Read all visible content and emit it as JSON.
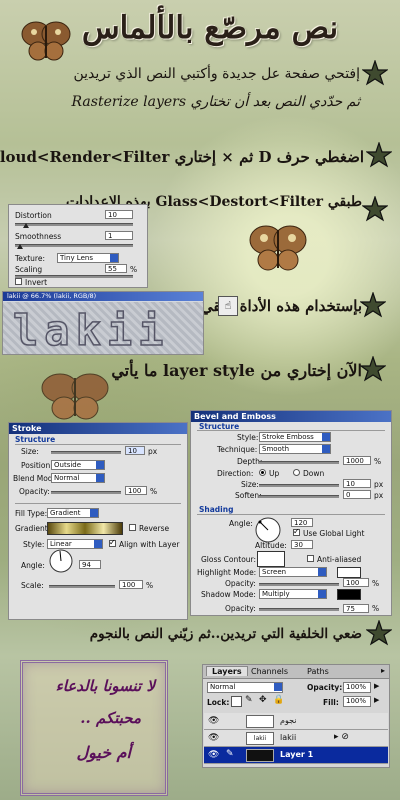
{
  "title": "نص مرصّع بالألماس",
  "steps": {
    "s1_line1": "إفتحي صفحة عل جديدة وأكتبي النص الذي تريدين",
    "s1_line2": "ثم حدّدي النص بعد أن تختاري Rasterize layers",
    "s2": "اضغطي حرف D ثم × إختاري cloud<Render<Filter",
    "s3": "طبقي Glass<Destort<Filter بهذه الإعدادات",
    "s4": "بإستخدام هذه الأداة عتقي النص قليلاً",
    "s5": "الآن إختاري من layer style ما يأتي",
    "s6": "ضعي الخلفية التي تريدين..ثم زيّني النص بالنجوم"
  },
  "glass_panel": {
    "distortion_label": "Distortion",
    "distortion_value": "10",
    "smoothness_label": "Smoothness",
    "smoothness_value": "1",
    "texture_label": "Texture:",
    "texture_value": "Tiny Lens",
    "scaling_label": "Scaling",
    "scaling_value": "55",
    "scaling_unit": "%",
    "invert_label": "Invert"
  },
  "canvas_strip": {
    "title": "lakii @ 66.7% (lakii, RGB/8)",
    "text": "lakii"
  },
  "stroke_panel": {
    "title": "Stroke",
    "section": "Structure",
    "size_label": "Size:",
    "size_value": "10",
    "size_unit": "px",
    "position_label": "Position:",
    "position_value": "Outside",
    "blend_label": "Blend Mode:",
    "blend_value": "Normal",
    "opacity_label": "Opacity:",
    "opacity_value": "100",
    "opacity_unit": "%",
    "filltype_label": "Fill Type:",
    "filltype_value": "Gradient",
    "gradient_label": "Gradient:",
    "reverse_label": "Reverse",
    "style_label": "Style:",
    "style_value": "Linear",
    "align_label": "Align with Layer",
    "angle_label": "Angle:",
    "angle_value": "94",
    "scale_label": "Scale:",
    "scale_value": "100",
    "scale_unit": "%"
  },
  "bevel_panel": {
    "title": "Bevel and Emboss",
    "section": "Structure",
    "style_label": "Style:",
    "style_value": "Stroke Emboss",
    "technique_label": "Technique:",
    "technique_value": "Smooth",
    "depth_label": "Depth:",
    "depth_value": "1000",
    "depth_unit": "%",
    "direction_label": "Direction:",
    "dir_up": "Up",
    "dir_down": "Down",
    "size_label": "Size:",
    "size_value": "10",
    "size_unit": "px",
    "soften_label": "Soften:",
    "soften_value": "0",
    "soften_unit": "px",
    "shading_section": "Shading",
    "angle_label": "Angle:",
    "angle_value": "120",
    "global_light_label": "Use Global Light",
    "altitude_label": "Altitude:",
    "altitude_value": "30",
    "gloss_label": "Gloss Contour:",
    "antialiased_label": "Anti-aliased",
    "highlight_label": "Highlight Mode:",
    "highlight_value": "Screen",
    "hl_opacity_label": "Opacity:",
    "hl_opacity_value": "100",
    "shadow_label": "Shadow Mode:",
    "shadow_value": "Multiply",
    "sh_opacity_label": "Opacity:",
    "sh_opacity_value": "75",
    "pct": "%"
  },
  "layers_panel": {
    "tabs": [
      "Layers",
      "Channels",
      "Paths"
    ],
    "blend_value": "Normal",
    "opacity_label": "Opacity:",
    "opacity_value": "100%",
    "lock_label": "Lock:",
    "fill_label": "Fill:",
    "fill_value": "100%",
    "layers": [
      "نجوم",
      "lakii",
      "Layer 1"
    ]
  },
  "signature": {
    "line1": "لا تنسونا بالدعاء",
    "line2": "محبتكم ..",
    "line3": "أم خيول"
  },
  "colors": {
    "accent_blue": "#123a9c",
    "selected_layer": "#0a2a9e",
    "signature_text": "#5a0f5a"
  }
}
